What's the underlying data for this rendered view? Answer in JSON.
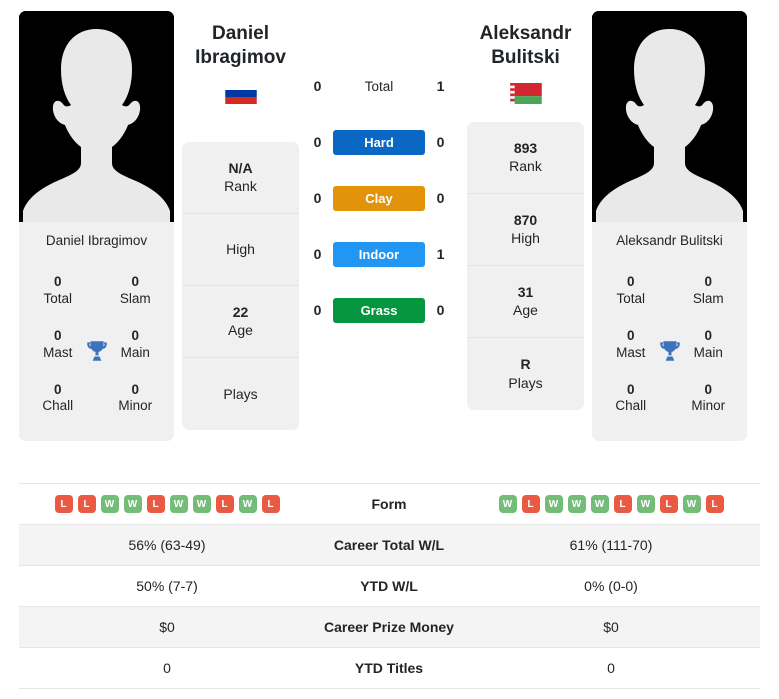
{
  "colors": {
    "hard": "#0a68c4",
    "clay": "#e3930a",
    "indoor": "#2196f3",
    "grass": "#069640",
    "win": "#74bd78",
    "loss": "#ea5a42",
    "card_bg": "#f0f0f0",
    "row_alt": "#f4f4f4"
  },
  "players": {
    "left": {
      "first_name": "Daniel",
      "last_name": "Ibragimov",
      "full_name": "Daniel Ibragimov",
      "country": "Russia",
      "flag_icon": "flag-russia",
      "avatar_icon": "avatar-placeholder",
      "titles": [
        {
          "value": "0",
          "label": "Total"
        },
        {
          "value": "0",
          "label": "Slam"
        },
        {
          "value": "0",
          "label": "Mast"
        },
        {
          "value": "0",
          "label": "Main"
        },
        {
          "value": "0",
          "label": "Chall"
        },
        {
          "value": "0",
          "label": "Minor"
        }
      ],
      "info": [
        {
          "value": "N/A",
          "label": "Rank"
        },
        {
          "value": "",
          "label": "High"
        },
        {
          "value": "22",
          "label": "Age"
        },
        {
          "value": "",
          "label": "Plays"
        }
      ],
      "form": [
        "L",
        "L",
        "W",
        "W",
        "L",
        "W",
        "W",
        "L",
        "W",
        "L"
      ]
    },
    "right": {
      "first_name": "Aleksandr",
      "last_name": "Bulitski",
      "full_name": "Aleksandr Bulitski",
      "country": "Belarus",
      "flag_icon": "flag-belarus",
      "avatar_icon": "avatar-placeholder",
      "titles": [
        {
          "value": "0",
          "label": "Total"
        },
        {
          "value": "0",
          "label": "Slam"
        },
        {
          "value": "0",
          "label": "Mast"
        },
        {
          "value": "0",
          "label": "Main"
        },
        {
          "value": "0",
          "label": "Chall"
        },
        {
          "value": "0",
          "label": "Minor"
        }
      ],
      "info": [
        {
          "value": "893",
          "label": "Rank"
        },
        {
          "value": "870",
          "label": "High"
        },
        {
          "value": "31",
          "label": "Age"
        },
        {
          "value": "R",
          "label": "Plays"
        }
      ],
      "form": [
        "W",
        "L",
        "W",
        "W",
        "W",
        "L",
        "W",
        "L",
        "W",
        "L"
      ]
    }
  },
  "head_to_head": [
    {
      "label": "Total",
      "left": "0",
      "right": "1",
      "style": "plain"
    },
    {
      "label": "Hard",
      "left": "0",
      "right": "0",
      "style": "hard"
    },
    {
      "label": "Clay",
      "left": "0",
      "right": "0",
      "style": "clay"
    },
    {
      "label": "Indoor",
      "left": "0",
      "right": "1",
      "style": "indoor"
    },
    {
      "label": "Grass",
      "left": "0",
      "right": "0",
      "style": "grass"
    }
  ],
  "stats_table": {
    "form_label": "Form",
    "rows": [
      {
        "label": "Career Total W/L",
        "left": "56% (63-49)",
        "right": "61% (111-70)"
      },
      {
        "label": "YTD W/L",
        "left": "50% (7-7)",
        "right": "0% (0-0)"
      },
      {
        "label": "Career Prize Money",
        "left": "$0",
        "right": "$0"
      },
      {
        "label": "YTD Titles",
        "left": "0",
        "right": "0"
      }
    ]
  }
}
